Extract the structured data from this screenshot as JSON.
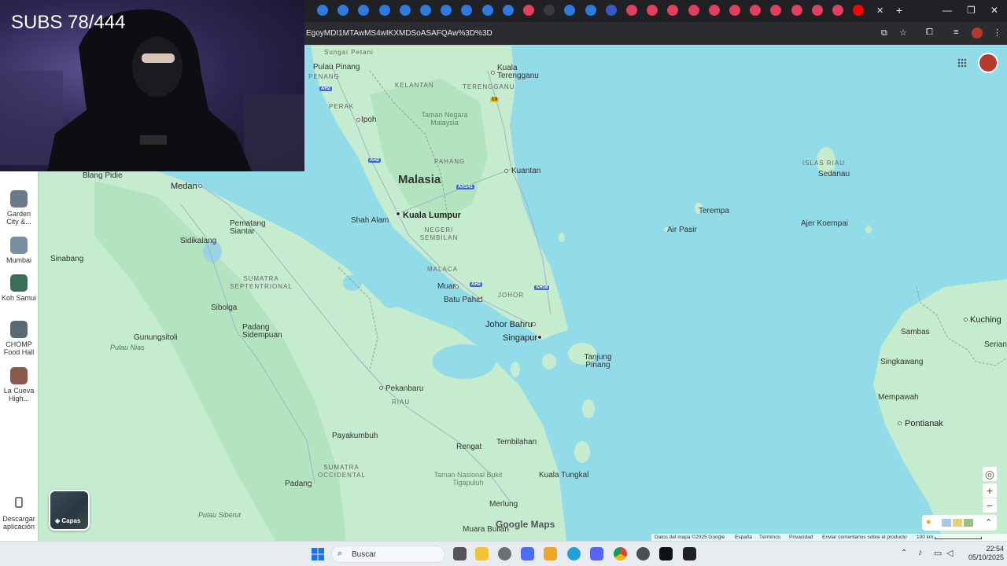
{
  "overlay": {
    "subs_text": "SUBS 78/444"
  },
  "browser": {
    "url": "EgoyMDI1MTAwMS4wIKXMDSoASAFQAw%3D%3D",
    "tabs_favicon_colors": [
      "#2d7be0",
      "#2d7be0",
      "#2d7be0",
      "#2d7be0",
      "#2d7be0",
      "#2d7be0",
      "#2d7be0",
      "#2d7be0",
      "#2d7be0",
      "#2d7be0",
      "#e0405e",
      "#3a3a3a",
      "#2d7be0",
      "#2d7be0",
      "#3a57c9",
      "#e0405e",
      "#e0405e",
      "#e0405e",
      "#e0405e",
      "#e0405e",
      "#e0405e",
      "#e0405e",
      "#e0405e",
      "#e0405e",
      "#e0405e",
      "#e0405e",
      "#ff0000"
    ],
    "icons": [
      "tab-favicon",
      "close-tab-icon",
      "new-tab-icon",
      "minimize-icon",
      "maximize-icon",
      "close-window-icon",
      "install-app-icon",
      "bookmark-star-icon",
      "extensions-icon",
      "media-icon",
      "profile-icon",
      "menu-icon"
    ]
  },
  "sidebar": {
    "recents": [
      {
        "label": "Garden City &...",
        "color": "#6b7a8a"
      },
      {
        "label": "Mumbai",
        "color": "#7a8ea4"
      },
      {
        "label": "Koh Samui",
        "color": "#3a6e58"
      },
      {
        "label": "CHOMP Food Hall",
        "color": "#5c6a78"
      },
      {
        "label": "La Cueva High...",
        "color": "#8a5a4a"
      }
    ],
    "download_label": "Descargar aplicación"
  },
  "map": {
    "layers_label": "Capas",
    "brand": "Google Maps",
    "labels": {
      "sungai_petani": "Sungai Petani",
      "pulau_pinang": "Pulau Pinang",
      "penang": "PENANG",
      "kelantan": "KELANTAN",
      "terengganu": "TERENGGANU",
      "kuala_terengganu": "Kuala Terengganu",
      "perak": "PERAK",
      "ipoh": "Ipoh",
      "taman_negara": "Taman Negara Malaysia",
      "pahang": "PAHANG",
      "kuantan": "Kuantan",
      "malasia": "Malasia",
      "kuala_lumpur": "Kuala Lumpur",
      "shah_alam": "Shah Alam",
      "negeri_sembilan": "NEGERI SEMBILAN",
      "malaca": "MALACA",
      "muar": "Muar",
      "johor": "JOHOR",
      "batu_pahat": "Batu Pahat",
      "johor_bahru": "Johor Bahru",
      "singapur": "Singapur",
      "tanjung_pinang": "Tanjung Pinang",
      "islas_riau": "ISLAS RIAU",
      "sedanau": "Sedanau",
      "terempa": "Terempa",
      "air_pasir": "Air Pasir",
      "ajer_koempai": "Ajer Koempai",
      "kuching": "Kuching",
      "sambas": "Sambas",
      "serian": "Serian",
      "singkawang": "Singkawang",
      "mempawah": "Mempawah",
      "pontianak": "Pontianak",
      "blang_pidie": "Blang Pidie",
      "medan": "Medan",
      "pematang_siantar": "Pematang Siantar",
      "sidikalang": "Sidikalang",
      "sinabang": "Sinabang",
      "sumatra_septentrional": "SUMATRA SEPTENTRIONAL",
      "sibolga": "Sibolga",
      "padang_sidempuan": "Padang Sidempuan",
      "gunungsitoli": "Gunungsitoli",
      "pulau_nias": "Pulau Nias",
      "pekanbaru": "Pekanbaru",
      "riau": "RIAU",
      "payakumbuh": "Payakumbuh",
      "rengat": "Rengat",
      "tembilahan": "Tembilahan",
      "kuala_tungkal": "Kuala Tungkal",
      "sumatra_occidental": "SUMATRA OCCIDENTAL",
      "padang": "Padang",
      "taman_bukit": "Taman Nasional Bukit Tigapuluh",
      "merlung": "Merlung",
      "muara_bulian": "Muara Bulian",
      "pulau_siberut": "Pulau Siberut"
    },
    "road_shields": [
      "E8",
      "AH2",
      "AH2",
      "AH141",
      "AH2",
      "AH18"
    ],
    "footer": {
      "data": "Datos del mapa ©2025 Google",
      "country": "España",
      "terms": "Términos",
      "privacy": "Privacidad",
      "feedback": "Enviar comentarios sobre el producto",
      "scale": "100 km"
    }
  },
  "taskbar": {
    "search_label": "Buscar",
    "time": "22:54",
    "date": "05/10/2025"
  },
  "colors": {
    "land": "#c9edd0",
    "water": "#92dbe8",
    "forest": "#b5e3c2"
  }
}
